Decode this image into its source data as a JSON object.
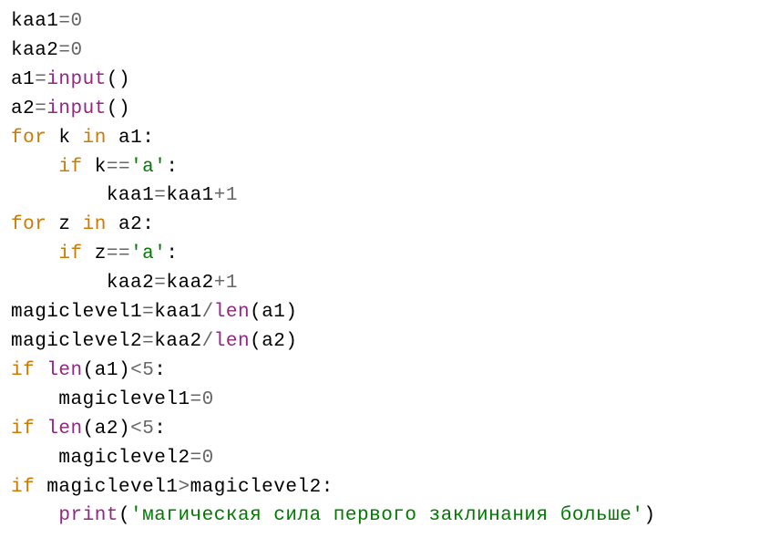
{
  "code": {
    "l1": {
      "v1": "kaa1",
      "op1": "=",
      "n1": "0"
    },
    "l2": {
      "v1": "kaa2",
      "op1": "=",
      "n1": "0"
    },
    "l3": {
      "v1": "a1",
      "op1": "=",
      "f1": "input",
      "p1": "(",
      "p2": ")"
    },
    "l4": {
      "v1": "a2",
      "op1": "=",
      "f1": "input",
      "p1": "(",
      "p2": ")"
    },
    "l5": {
      "kw1": "for",
      "sp1": " ",
      "v1": "k",
      "sp2": " ",
      "kw2": "in",
      "sp3": " ",
      "v2": "a1",
      "c1": ":"
    },
    "l6": {
      "ind": "    ",
      "kw1": "if",
      "sp1": " ",
      "v1": "k",
      "op1": "==",
      "s1": "'a'",
      "c1": ":"
    },
    "l7": {
      "ind": "        ",
      "v1": "kaa1",
      "op1": "=",
      "v2": "kaa1",
      "op2": "+",
      "n1": "1"
    },
    "l8": {
      "kw1": "for",
      "sp1": " ",
      "v1": "z",
      "sp2": " ",
      "kw2": "in",
      "sp3": " ",
      "v2": "a2",
      "c1": ":"
    },
    "l9": {
      "ind": "    ",
      "kw1": "if",
      "sp1": " ",
      "v1": "z",
      "op1": "==",
      "s1": "'a'",
      "c1": ":"
    },
    "l10": {
      "ind": "        ",
      "v1": "kaa2",
      "op1": "=",
      "v2": "kaa2",
      "op2": "+",
      "n1": "1"
    },
    "l11": {
      "v1": "magiclevel1",
      "op1": "=",
      "v2": "kaa1",
      "op2": "/",
      "f1": "len",
      "p1": "(",
      "v3": "a1",
      "p2": ")"
    },
    "l12": {
      "v1": "magiclevel2",
      "op1": "=",
      "v2": "kaa2",
      "op2": "/",
      "f1": "len",
      "p1": "(",
      "v3": "a2",
      "p2": ")"
    },
    "l13": {
      "kw1": "if",
      "sp1": " ",
      "f1": "len",
      "p1": "(",
      "v1": "a1",
      "p2": ")",
      "op1": "<",
      "n1": "5",
      "c1": ":"
    },
    "l14": {
      "ind": "    ",
      "v1": "magiclevel1",
      "op1": "=",
      "n1": "0"
    },
    "l15": {
      "kw1": "if",
      "sp1": " ",
      "f1": "len",
      "p1": "(",
      "v1": "a2",
      "p2": ")",
      "op1": "<",
      "n1": "5",
      "c1": ":"
    },
    "l16": {
      "ind": "    ",
      "v1": "magiclevel2",
      "op1": "=",
      "n1": "0"
    },
    "l17": {
      "kw1": "if",
      "sp1": " ",
      "v1": "magiclevel1",
      "op1": ">",
      "v2": "magiclevel2",
      "c1": ":"
    },
    "l18": {
      "ind": "    ",
      "f1": "print",
      "p1": "(",
      "s1": "'магическая сила первого заклинания больше'",
      "p2": ")"
    }
  }
}
